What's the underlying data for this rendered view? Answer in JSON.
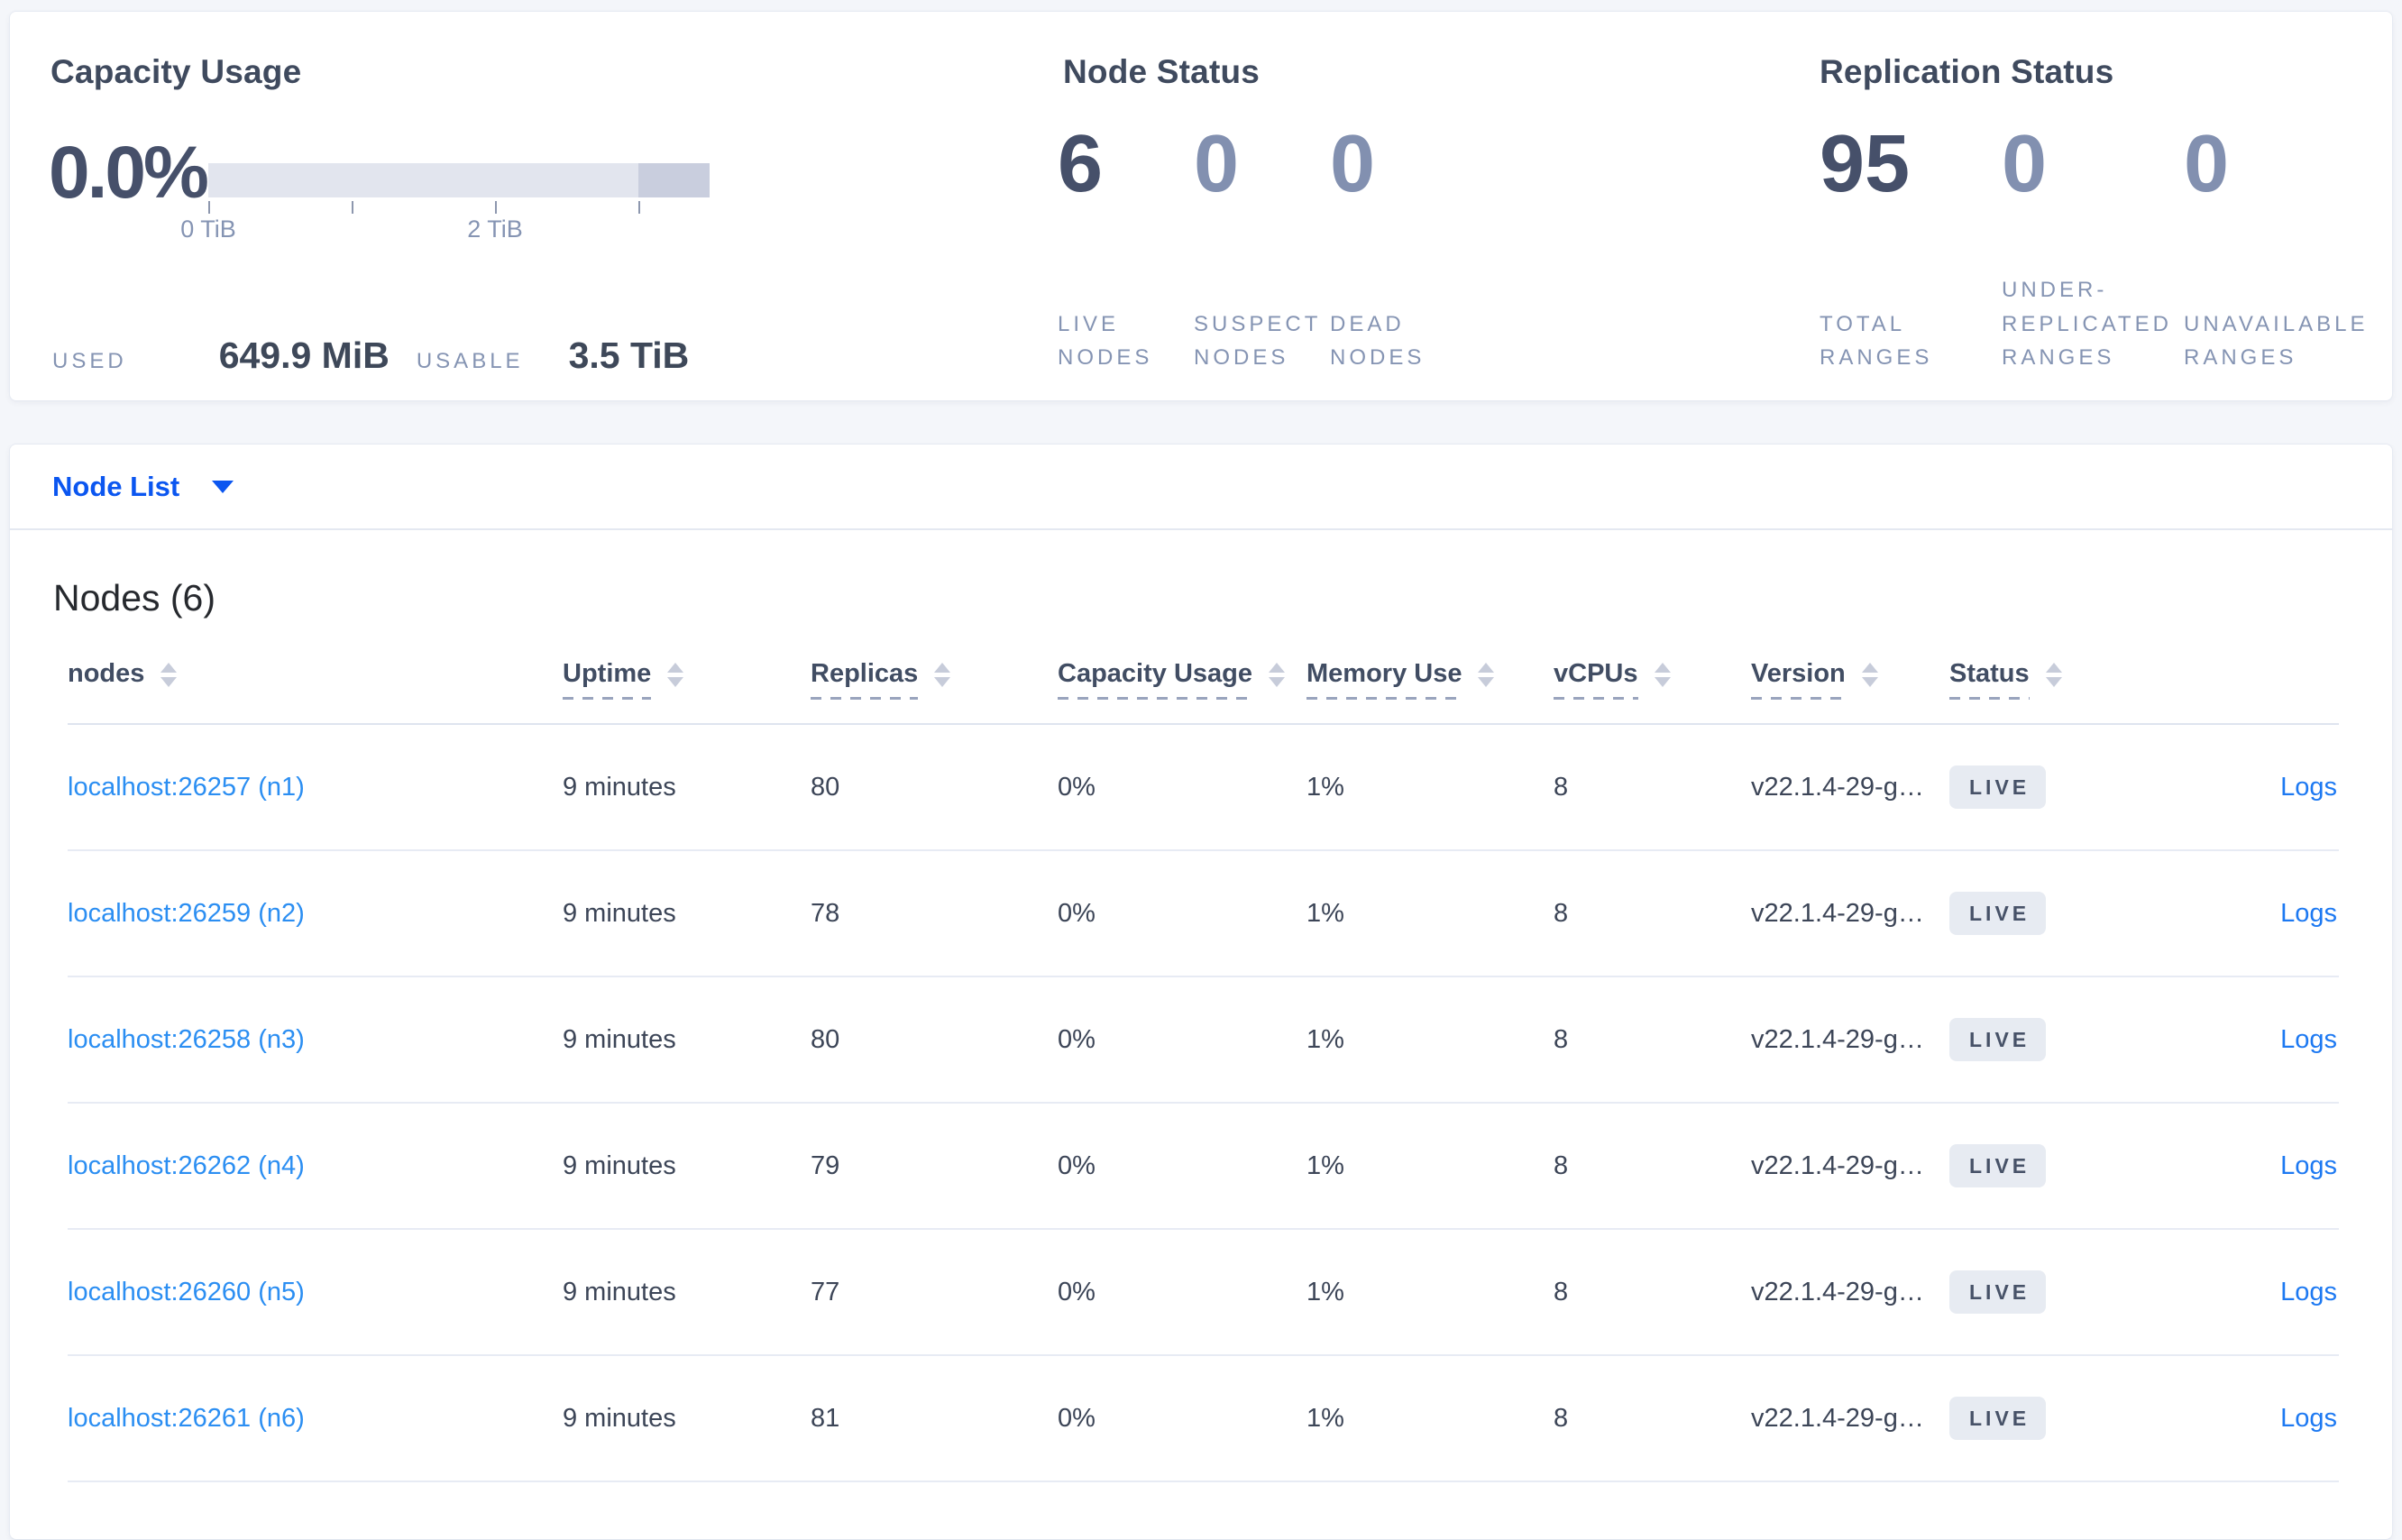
{
  "summary": {
    "capacity_usage": {
      "title": "Capacity Usage",
      "percent_used": "0.0%",
      "bar": {
        "total_tib": 3.5,
        "tick_interval_tib": 1,
        "highlight_from_tib": 3.0,
        "tick_labels": [
          {
            "text": "0 TiB",
            "at_tib": 0
          },
          {
            "text": "2 TiB",
            "at_tib": 2
          }
        ]
      },
      "stats": [
        {
          "label": "USED",
          "value": "649.9 MiB"
        },
        {
          "label": "USABLE",
          "value": "3.5 TiB"
        }
      ]
    },
    "node_status": {
      "title": "Node Status",
      "metrics": [
        {
          "value": "6",
          "label": "LIVE NODES"
        },
        {
          "value": "0",
          "label": "SUSPECT NODES"
        },
        {
          "value": "0",
          "label": "DEAD NODES"
        }
      ]
    },
    "replication_status": {
      "title": "Replication Status",
      "metrics": [
        {
          "value": "95",
          "label": "TOTAL RANGES"
        },
        {
          "value": "0",
          "label": "UNDER-REPLICATED RANGES"
        },
        {
          "value": "0",
          "label": "UNAVAILABLE RANGES"
        }
      ]
    }
  },
  "view_selector": {
    "label": "Node List"
  },
  "nodes_table": {
    "title": "Nodes (6)",
    "columns": [
      {
        "key": "node",
        "label": "nodes",
        "sortable": true,
        "dashed": false
      },
      {
        "key": "uptime",
        "label": "Uptime",
        "sortable": true,
        "dashed": true
      },
      {
        "key": "replicas",
        "label": "Replicas",
        "sortable": true,
        "dashed": true
      },
      {
        "key": "capacity_usage",
        "label": "Capacity Usage",
        "sortable": true,
        "dashed": true
      },
      {
        "key": "memory_use",
        "label": "Memory Use",
        "sortable": true,
        "dashed": true
      },
      {
        "key": "vcpus",
        "label": "vCPUs",
        "sortable": true,
        "dashed": true
      },
      {
        "key": "version",
        "label": "Version",
        "sortable": true,
        "dashed": true
      },
      {
        "key": "status",
        "label": "Status",
        "sortable": true,
        "dashed": true
      },
      {
        "key": "logs",
        "label": "",
        "sortable": false,
        "dashed": false
      }
    ],
    "rows": [
      {
        "node": "localhost:26257 (n1)",
        "uptime": "9 minutes",
        "replicas": "80",
        "capacity_usage": "0%",
        "memory_use": "1%",
        "vcpus": "8",
        "version": "v22.1.4-29-g…",
        "status": "LIVE",
        "logs": "Logs"
      },
      {
        "node": "localhost:26259 (n2)",
        "uptime": "9 minutes",
        "replicas": "78",
        "capacity_usage": "0%",
        "memory_use": "1%",
        "vcpus": "8",
        "version": "v22.1.4-29-g…",
        "status": "LIVE",
        "logs": "Logs"
      },
      {
        "node": "localhost:26258 (n3)",
        "uptime": "9 minutes",
        "replicas": "80",
        "capacity_usage": "0%",
        "memory_use": "1%",
        "vcpus": "8",
        "version": "v22.1.4-29-g…",
        "status": "LIVE",
        "logs": "Logs"
      },
      {
        "node": "localhost:26262 (n4)",
        "uptime": "9 minutes",
        "replicas": "79",
        "capacity_usage": "0%",
        "memory_use": "1%",
        "vcpus": "8",
        "version": "v22.1.4-29-g…",
        "status": "LIVE",
        "logs": "Logs"
      },
      {
        "node": "localhost:26260 (n5)",
        "uptime": "9 minutes",
        "replicas": "77",
        "capacity_usage": "0%",
        "memory_use": "1%",
        "vcpus": "8",
        "version": "v22.1.4-29-g…",
        "status": "LIVE",
        "logs": "Logs"
      },
      {
        "node": "localhost:26261 (n6)",
        "uptime": "9 minutes",
        "replicas": "81",
        "capacity_usage": "0%",
        "memory_use": "1%",
        "vcpus": "8",
        "version": "v22.1.4-29-g…",
        "status": "LIVE",
        "logs": "Logs"
      }
    ]
  },
  "colors": {
    "primary_blue": "#0b56f0",
    "node_link_blue": "#2b8ef2",
    "logs_link_blue": "#1d79f2",
    "badge_bg": "#e7ebf2",
    "bar_track": "#e2e5ee",
    "bar_highlight": "#c9cede",
    "page_bg": "#f4f6fa"
  }
}
